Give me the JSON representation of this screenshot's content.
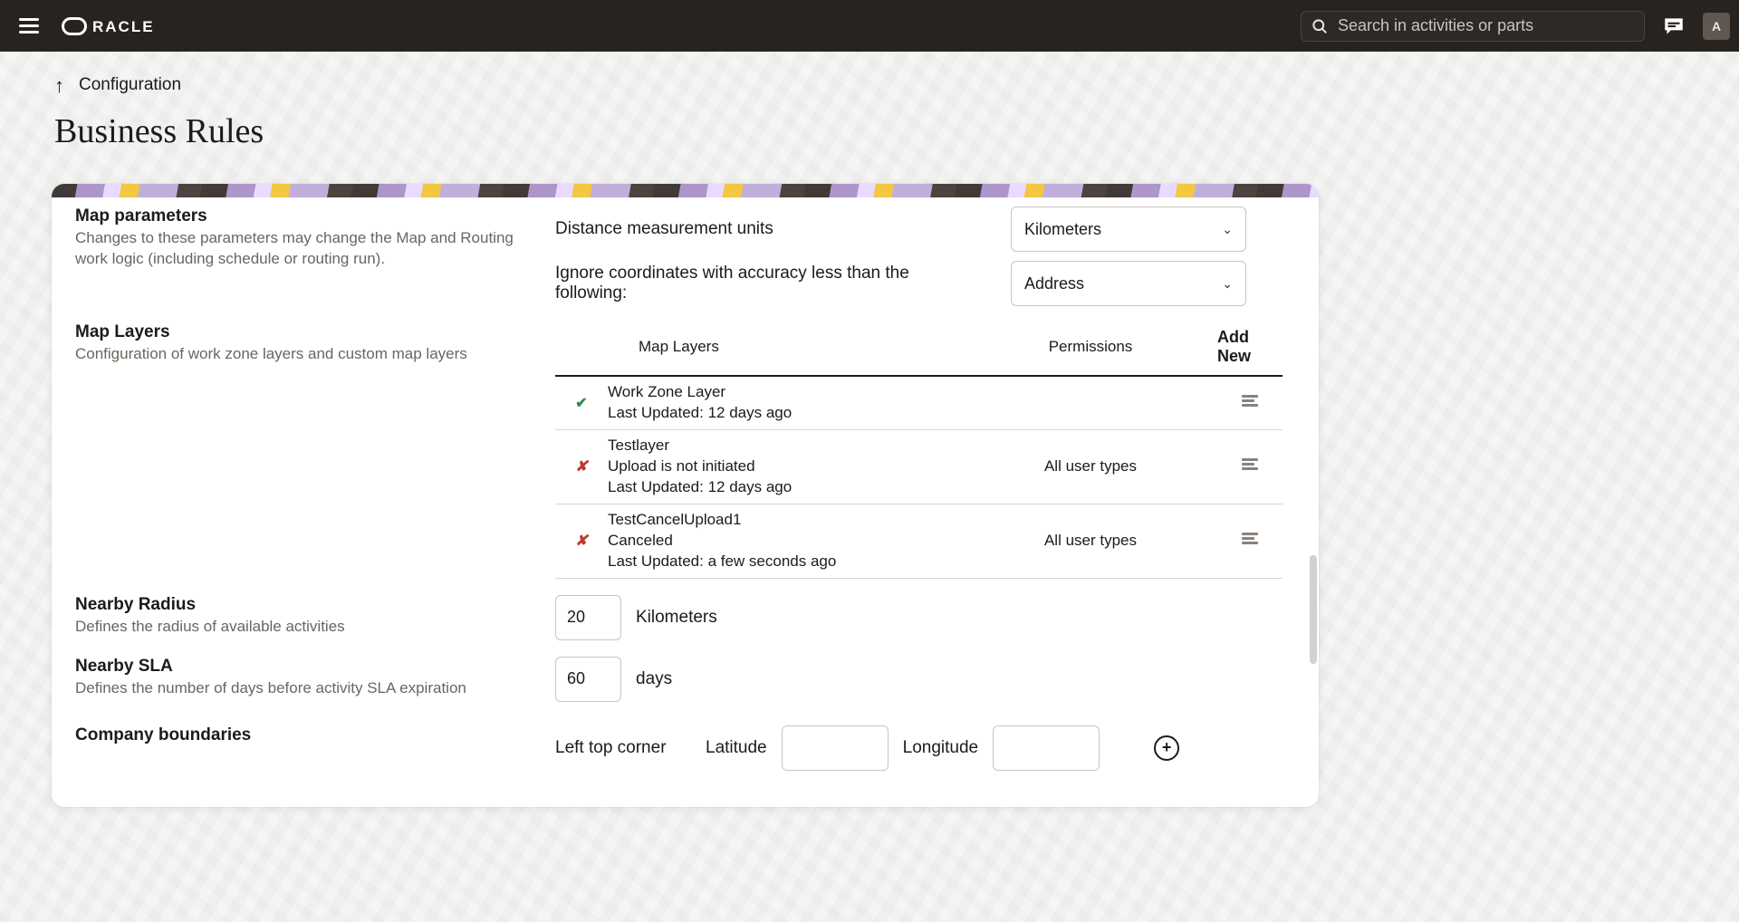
{
  "header": {
    "search_placeholder": "Search in activities or parts",
    "avatar_initial": "A"
  },
  "breadcrumb": {
    "label": "Configuration"
  },
  "page_title": "Business Rules",
  "map_params": {
    "title": "Map parameters",
    "desc": "Changes to these parameters may change the Map and Routing work logic (including schedule or routing run).",
    "distance_label": "Distance measurement units",
    "distance_value": "Kilometers",
    "accuracy_label": "Ignore coordinates with accuracy less than the following:",
    "accuracy_value": "Address"
  },
  "map_layers": {
    "title": "Map Layers",
    "desc": "Configuration of work zone layers and custom map layers",
    "th_layers": "Map Layers",
    "th_perm": "Permissions",
    "add_new": "Add New",
    "rows": [
      {
        "status": "ok",
        "name": "Work Zone Layer",
        "line2": "Last Updated: 12 days ago",
        "line3": "",
        "perm": ""
      },
      {
        "status": "bad",
        "name": "Testlayer",
        "line2": "Upload is not initiated",
        "line3": "Last Updated: 12 days ago",
        "perm": "All user types"
      },
      {
        "status": "bad",
        "name": "TestCancelUpload1",
        "line2": "Canceled",
        "line3": "Last Updated: a few seconds ago",
        "perm": "All user types"
      }
    ]
  },
  "nearby_radius": {
    "title": "Nearby Radius",
    "desc": "Defines the radius of available activities",
    "value": "20",
    "unit": "Kilometers"
  },
  "nearby_sla": {
    "title": "Nearby SLA",
    "desc": "Defines the number of days before activity SLA expiration",
    "value": "60",
    "unit": "days"
  },
  "company_boundaries": {
    "title": "Company boundaries",
    "left_top": "Left top corner",
    "lat": "Latitude",
    "lon": "Longitude"
  }
}
